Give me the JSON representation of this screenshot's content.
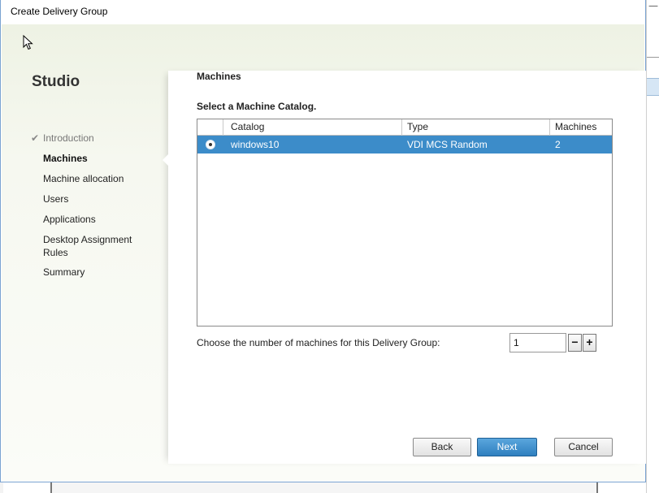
{
  "window": {
    "title": "Create Delivery Group"
  },
  "sidebar": {
    "brand": "Studio",
    "steps": [
      {
        "label": "Introduction",
        "state": "done"
      },
      {
        "label": "Machines",
        "state": "current"
      },
      {
        "label": "Machine allocation",
        "state": "pending"
      },
      {
        "label": "Users",
        "state": "pending"
      },
      {
        "label": "Applications",
        "state": "pending"
      },
      {
        "label": "Desktop Assignment Rules",
        "state": "pending"
      },
      {
        "label": "Summary",
        "state": "pending"
      }
    ]
  },
  "main": {
    "section_title": "Machines",
    "select_label": "Select a Machine Catalog.",
    "catalog_table": {
      "columns": [
        "Catalog",
        "Type",
        "Machines"
      ],
      "rows": [
        {
          "catalog": "windows10",
          "type": "VDI MCS Random",
          "machines": "2",
          "selected": true
        }
      ]
    },
    "machine_count": {
      "label": "Choose the number of machines for this Delivery Group:",
      "value": "1",
      "decrement": "−",
      "increment": "+"
    }
  },
  "footer": {
    "back": "Back",
    "next": "Next",
    "cancel": "Cancel"
  },
  "colors": {
    "selection": "#3c8cc9",
    "primary_button": "#2f7fbf"
  }
}
